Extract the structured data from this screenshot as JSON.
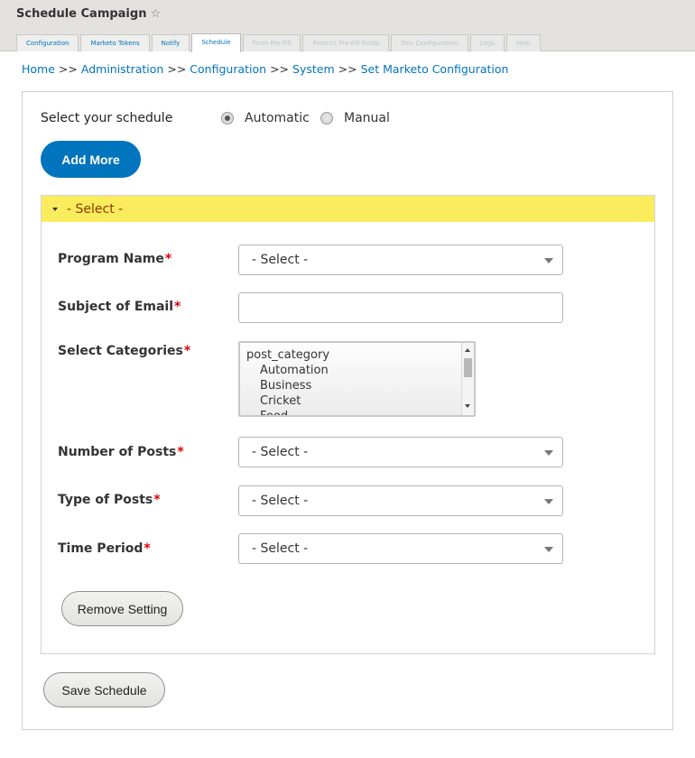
{
  "page": {
    "title": "Schedule Campaign",
    "star_icon": "star-icon"
  },
  "tabs": [
    {
      "label": "Configuration",
      "state": "normal"
    },
    {
      "label": "Marketo Tokens",
      "state": "normal"
    },
    {
      "label": "Notify",
      "state": "normal"
    },
    {
      "label": "Schedule",
      "state": "active"
    },
    {
      "label": "Form Pre-Fill",
      "state": "faded"
    },
    {
      "label": "Restrict Pre-Fill Fields",
      "state": "faded"
    },
    {
      "label": "Dev Configuration",
      "state": "faded"
    },
    {
      "label": "Logs",
      "state": "faded"
    },
    {
      "label": "Help",
      "state": "faded"
    }
  ],
  "breadcrumb": {
    "items": [
      "Home",
      "Administration",
      "Configuration",
      "System",
      "Set Marketo Configuration"
    ],
    "separator": ">>"
  },
  "schedule": {
    "label": "Select your schedule",
    "options": [
      {
        "label": "Automatic",
        "checked": true
      },
      {
        "label": "Manual",
        "checked": false
      }
    ]
  },
  "add_more_label": "Add More",
  "settings": {
    "legend": "- Select -",
    "required_mark": "*",
    "program_name": {
      "label": "Program Name",
      "value": "- Select -"
    },
    "subject_of_email": {
      "label": "Subject of Email",
      "value": ""
    },
    "select_categories": {
      "label": "Select Categories",
      "group": "post_category",
      "options": [
        "Automation",
        "Business",
        "Cricket",
        "Food"
      ]
    },
    "number_of_posts": {
      "label": "Number of Posts",
      "value": "- Select -"
    },
    "type_of_posts": {
      "label": "Type of Posts",
      "value": "- Select -"
    },
    "time_period": {
      "label": "Time Period",
      "value": "- Select -"
    },
    "remove_label": "Remove Setting"
  },
  "save_label": "Save Schedule",
  "colors": {
    "link": "#0074bd",
    "primary_button": "#0074bd",
    "legend_bar": "#fbec5e",
    "legend_text": "#8b3a00",
    "required": "#e00000"
  }
}
